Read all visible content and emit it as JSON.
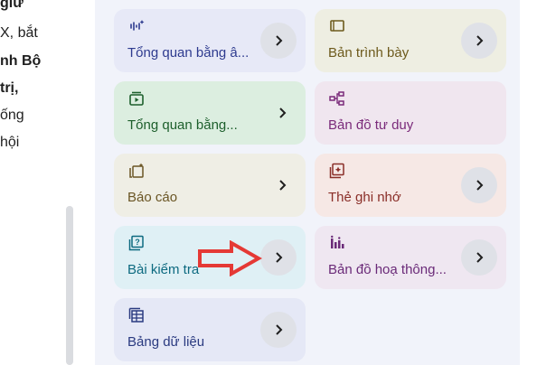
{
  "left_text": {
    "lines": [
      {
        "text": "giữ",
        "bold": true
      },
      {
        "text": "X, bắt",
        "bold": false
      },
      {
        "text": "nh Bộ",
        "bold": true
      },
      {
        "text": "trị,",
        "bold": true
      },
      {
        "text": "ống",
        "bold": false
      },
      {
        "text": "hội",
        "bold": false
      }
    ]
  },
  "cards": {
    "audio_overview": {
      "label": "Tổng quan bằng â...",
      "icon": "audio-waveform-icon"
    },
    "slides": {
      "label": "Bản trình bày",
      "icon": "slides-icon"
    },
    "video_overview": {
      "label": "Tổng quan bằng...",
      "icon": "video-icon"
    },
    "mind_map": {
      "label": "Bản đồ tư duy",
      "icon": "mind-map-icon"
    },
    "report": {
      "label": "Báo cáo",
      "icon": "report-icon"
    },
    "flashcards": {
      "label": "Thẻ ghi nhớ",
      "icon": "flashcard-icon"
    },
    "quiz": {
      "label": "Bài kiểm tra",
      "icon": "quiz-icon"
    },
    "infographic": {
      "label": "Bản đồ hoạ thông...",
      "icon": "infographic-icon"
    },
    "data_table": {
      "label": "Bảng dữ liệu",
      "icon": "table-icon"
    }
  },
  "annotation": {
    "color": "#e53935",
    "icon": "red-arrow-icon"
  }
}
